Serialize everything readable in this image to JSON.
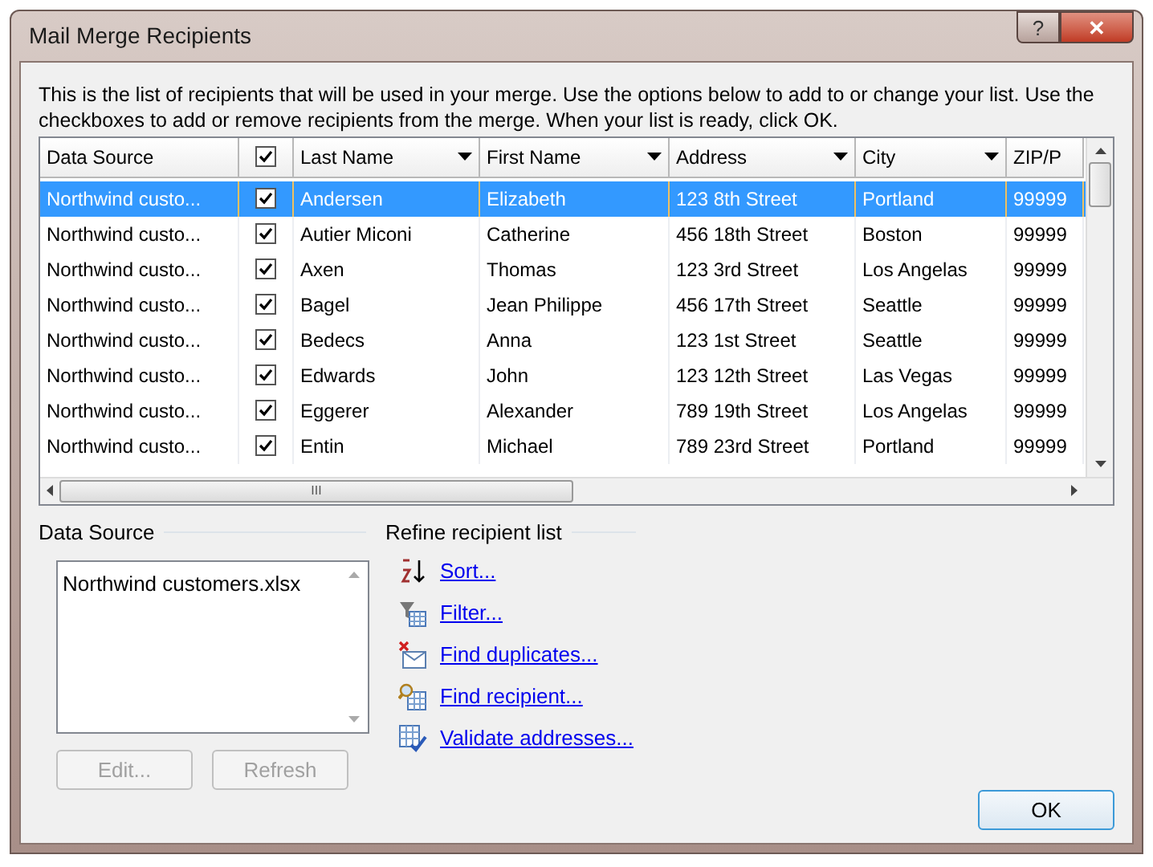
{
  "window": {
    "title": "Mail Merge Recipients",
    "buttons": [
      "?",
      "✕"
    ]
  },
  "intro": "This is the list of recipients that will be used in your merge.  Use the options below to add to or change your list.  Use the checkboxes to add or remove recipients from the merge.  When your list is ready, click OK.",
  "table": {
    "columns": [
      {
        "label": "Data Source",
        "kind": "text"
      },
      {
        "kind": "check",
        "checked": true
      },
      {
        "label": "Last Name",
        "kind": "dropdown"
      },
      {
        "label": "First Name",
        "kind": "dropdown"
      },
      {
        "label": "Address",
        "kind": "dropdown"
      },
      {
        "label": "City",
        "kind": "dropdown"
      },
      {
        "label": "ZIP/P",
        "kind": "text"
      }
    ],
    "rows": [
      {
        "selected": true,
        "cells": [
          "Northwind custo...",
          {
            "checked": true
          },
          "Andersen",
          "Elizabeth",
          "123 8th Street",
          "Portland",
          "99999"
        ]
      },
      {
        "selected": false,
        "cells": [
          "Northwind custo...",
          {
            "checked": true
          },
          "Autier Miconi",
          "Catherine",
          "456 18th Street",
          "Boston",
          "99999"
        ]
      },
      {
        "selected": false,
        "cells": [
          "Northwind custo...",
          {
            "checked": true
          },
          "Axen",
          "Thomas",
          "123 3rd Street",
          "Los Angelas",
          "99999"
        ]
      },
      {
        "selected": false,
        "cells": [
          "Northwind custo...",
          {
            "checked": true
          },
          "Bagel",
          "Jean Philippe",
          "456 17th Street",
          "Seattle",
          "99999"
        ]
      },
      {
        "selected": false,
        "cells": [
          "Northwind custo...",
          {
            "checked": true
          },
          "Bedecs",
          "Anna",
          "123 1st Street",
          "Seattle",
          "99999"
        ]
      },
      {
        "selected": false,
        "cells": [
          "Northwind custo...",
          {
            "checked": true
          },
          "Edwards",
          "John",
          "123 12th Street",
          "Las Vegas",
          "99999"
        ]
      },
      {
        "selected": false,
        "cells": [
          "Northwind custo...",
          {
            "checked": true
          },
          "Eggerer",
          "Alexander",
          "789 19th Street",
          "Los Angelas",
          "99999"
        ]
      },
      {
        "selected": false,
        "cells": [
          "Northwind custo...",
          {
            "checked": true
          },
          "Entin",
          "Michael",
          "789 23rd Street",
          "Portland",
          "99999"
        ]
      }
    ],
    "scroll_grip": "III"
  },
  "data_source": {
    "title": "Data Source",
    "items": [
      "Northwind customers.xlsx"
    ],
    "buttons": [
      {
        "label": "Edit...",
        "disabled": true
      },
      {
        "label": "Refresh",
        "disabled": true
      }
    ]
  },
  "refine": {
    "title": "Refine recipient list",
    "links": [
      "Sort...",
      "Filter...",
      "Find duplicates...",
      "Find recipient...",
      "Validate addresses..."
    ]
  },
  "ok_button": "OK"
}
